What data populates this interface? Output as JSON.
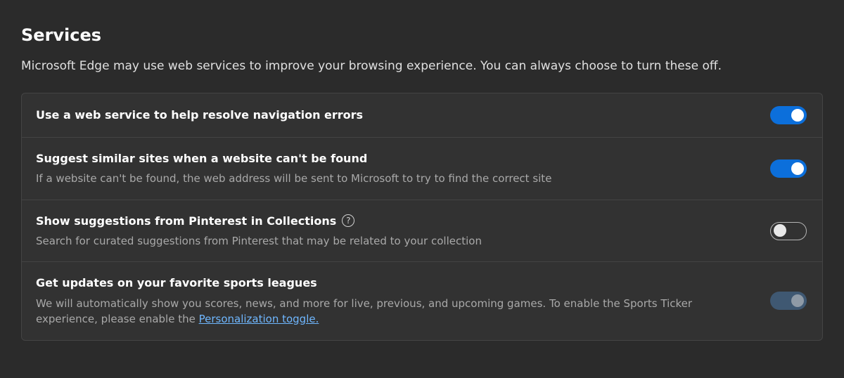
{
  "section": {
    "title": "Services",
    "description": "Microsoft Edge may use web services to improve your browsing experience. You can always choose to turn these off."
  },
  "settings": {
    "nav_errors": {
      "title": "Use a web service to help resolve navigation errors",
      "state": "on"
    },
    "similar_sites": {
      "title": "Suggest similar sites when a website can't be found",
      "sub": "If a website can't be found, the web address will be sent to Microsoft to try to find the correct site",
      "state": "on"
    },
    "pinterest": {
      "title": "Show suggestions from Pinterest in Collections",
      "sub": "Search for curated suggestions from Pinterest that may be related to your collection",
      "state": "off",
      "help_glyph": "?"
    },
    "sports": {
      "title": "Get updates on your favorite sports leagues",
      "sub_pre": "We will automatically show you scores, news, and more for live, previous, and upcoming games. To enable the Sports Ticker experience, please enable the ",
      "link": "Personalization toggle.",
      "state": "disabled"
    }
  }
}
